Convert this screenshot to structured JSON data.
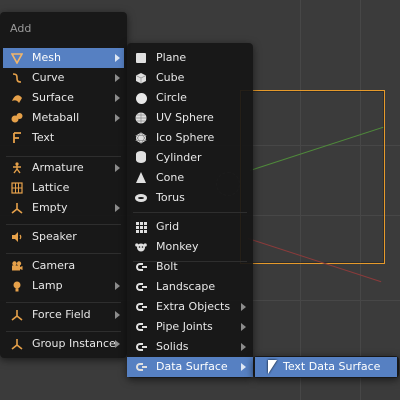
{
  "add_menu": {
    "title": "Add",
    "items": [
      {
        "label": "Mesh",
        "icon": "mesh-icon",
        "submenu": true,
        "active": true
      },
      {
        "label": "Curve",
        "icon": "curve-icon",
        "submenu": true
      },
      {
        "label": "Surface",
        "icon": "surface-icon",
        "submenu": true
      },
      {
        "label": "Metaball",
        "icon": "metaball-icon",
        "submenu": true
      },
      {
        "label": "Text",
        "icon": "text-icon",
        "submenu": false
      },
      {
        "label": "Armature",
        "icon": "armature-icon",
        "submenu": true
      },
      {
        "label": "Lattice",
        "icon": "lattice-icon",
        "submenu": false
      },
      {
        "label": "Empty",
        "icon": "empty-icon",
        "submenu": true
      },
      {
        "label": "Speaker",
        "icon": "speaker-icon",
        "submenu": false
      },
      {
        "label": "Camera",
        "icon": "camera-icon",
        "submenu": false
      },
      {
        "label": "Lamp",
        "icon": "lamp-icon",
        "submenu": true
      },
      {
        "label": "Force Field",
        "icon": "force-field-icon",
        "submenu": true
      },
      {
        "label": "Group Instance",
        "icon": "group-instance-icon",
        "submenu": true
      }
    ]
  },
  "mesh_menu": {
    "items": [
      {
        "label": "Plane",
        "icon": "plane-icon"
      },
      {
        "label": "Cube",
        "icon": "cube-icon"
      },
      {
        "label": "Circle",
        "icon": "circle-icon"
      },
      {
        "label": "UV Sphere",
        "icon": "uv-sphere-icon"
      },
      {
        "label": "Ico Sphere",
        "icon": "ico-sphere-icon"
      },
      {
        "label": "Cylinder",
        "icon": "cylinder-icon"
      },
      {
        "label": "Cone",
        "icon": "cone-icon"
      },
      {
        "label": "Torus",
        "icon": "torus-icon"
      },
      {
        "label": "Grid",
        "icon": "grid-icon"
      },
      {
        "label": "Monkey",
        "icon": "monkey-icon"
      },
      {
        "label": "Bolt",
        "icon": "plugin-icon"
      },
      {
        "label": "Landscape",
        "icon": "plugin-icon"
      },
      {
        "label": "Extra Objects",
        "icon": "plugin-icon",
        "submenu": true
      },
      {
        "label": "Pipe Joints",
        "icon": "plugin-icon",
        "submenu": true
      },
      {
        "label": "Solids",
        "icon": "plugin-icon",
        "submenu": true
      },
      {
        "label": "Data Surface",
        "icon": "plugin-icon",
        "submenu": true,
        "active": true
      }
    ]
  },
  "data_surface_menu": {
    "items": [
      {
        "label": "Text Data Surface",
        "active": true
      }
    ]
  },
  "colors": {
    "highlight": "#5680c2",
    "menu_bg": "#161616",
    "selection_outline": "#e69a2b"
  }
}
